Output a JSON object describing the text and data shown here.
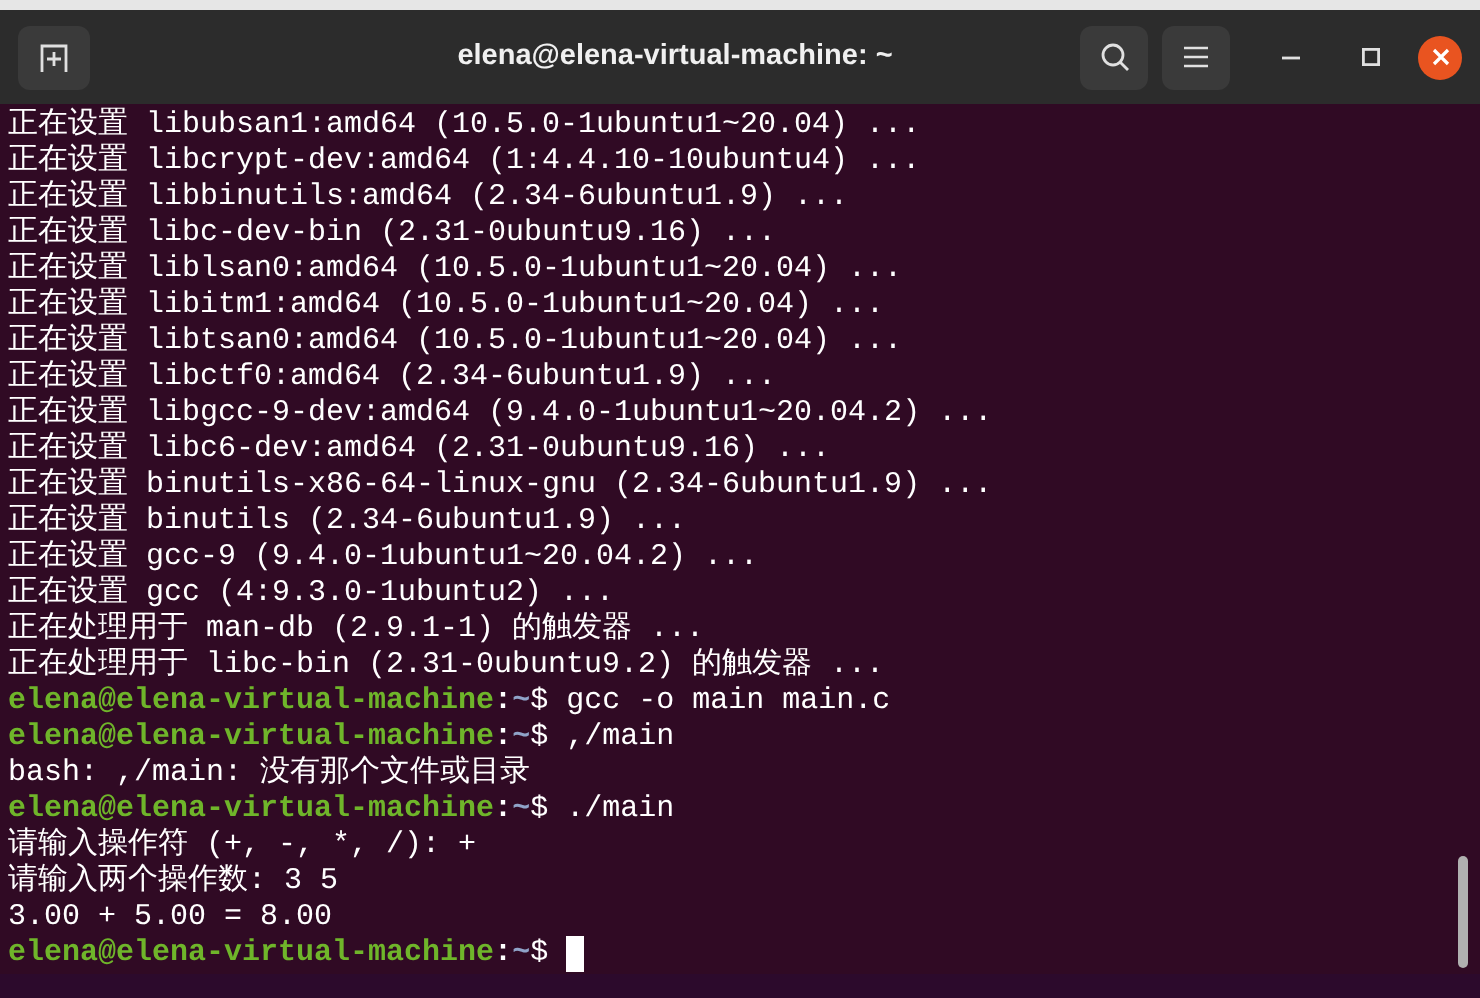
{
  "window": {
    "title": "elena@elena-virtual-machine: ~"
  },
  "terminal": {
    "lines": [
      {
        "kind": "output",
        "text": "正在设置 libubsan1:amd64 (10.5.0-1ubuntu1~20.04) ..."
      },
      {
        "kind": "output",
        "text": "正在设置 libcrypt-dev:amd64 (1:4.4.10-10ubuntu4) ..."
      },
      {
        "kind": "output",
        "text": "正在设置 libbinutils:amd64 (2.34-6ubuntu1.9) ..."
      },
      {
        "kind": "output",
        "text": "正在设置 libc-dev-bin (2.31-0ubuntu9.16) ..."
      },
      {
        "kind": "output",
        "text": "正在设置 liblsan0:amd64 (10.5.0-1ubuntu1~20.04) ..."
      },
      {
        "kind": "output",
        "text": "正在设置 libitm1:amd64 (10.5.0-1ubuntu1~20.04) ..."
      },
      {
        "kind": "output",
        "text": "正在设置 libtsan0:amd64 (10.5.0-1ubuntu1~20.04) ..."
      },
      {
        "kind": "output",
        "text": "正在设置 libctf0:amd64 (2.34-6ubuntu1.9) ..."
      },
      {
        "kind": "output",
        "text": "正在设置 libgcc-9-dev:amd64 (9.4.0-1ubuntu1~20.04.2) ..."
      },
      {
        "kind": "output",
        "text": "正在设置 libc6-dev:amd64 (2.31-0ubuntu9.16) ..."
      },
      {
        "kind": "output",
        "text": "正在设置 binutils-x86-64-linux-gnu (2.34-6ubuntu1.9) ..."
      },
      {
        "kind": "output",
        "text": "正在设置 binutils (2.34-6ubuntu1.9) ..."
      },
      {
        "kind": "output",
        "text": "正在设置 gcc-9 (9.4.0-1ubuntu1~20.04.2) ..."
      },
      {
        "kind": "output",
        "text": "正在设置 gcc (4:9.3.0-1ubuntu2) ..."
      },
      {
        "kind": "output",
        "text": "正在处理用于 man-db (2.9.1-1) 的触发器 ..."
      },
      {
        "kind": "output",
        "text": "正在处理用于 libc-bin (2.31-0ubuntu9.2) 的触发器 ..."
      },
      {
        "kind": "prompt",
        "user_host": "elena@elena-virtual-machine",
        "separator": ":",
        "path": "~",
        "symbol": "$",
        "command": "gcc -o main main.c",
        "cursor": false
      },
      {
        "kind": "prompt",
        "user_host": "elena@elena-virtual-machine",
        "separator": ":",
        "path": "~",
        "symbol": "$",
        "command": ",/main",
        "cursor": false
      },
      {
        "kind": "output",
        "text": "bash: ,/main: 没有那个文件或目录"
      },
      {
        "kind": "prompt",
        "user_host": "elena@elena-virtual-machine",
        "separator": ":",
        "path": "~",
        "symbol": "$",
        "command": "./main",
        "cursor": false
      },
      {
        "kind": "output",
        "text": "请输入操作符 (+, -, *, /): +"
      },
      {
        "kind": "output",
        "text": "请输入两个操作数: 3 5"
      },
      {
        "kind": "output",
        "text": "3.00 + 5.00 = 8.00"
      },
      {
        "kind": "prompt",
        "user_host": "elena@elena-virtual-machine",
        "separator": ":",
        "path": "~",
        "symbol": "$",
        "cursor": true
      }
    ]
  }
}
